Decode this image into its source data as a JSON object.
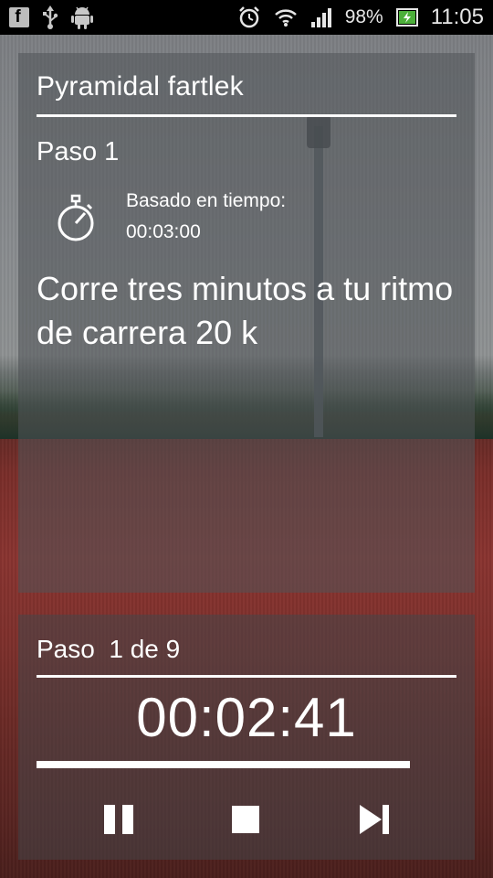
{
  "status_bar": {
    "left_icons": [
      "facebook-icon",
      "usb-icon",
      "android-icon"
    ],
    "right_icons": [
      "alarm-icon",
      "wifi-icon",
      "signal-icon",
      "battery-icon"
    ],
    "battery_percent": "98%",
    "time": "11:05"
  },
  "workout": {
    "title": "Pyramidal fartlek",
    "step_heading": "Paso 1",
    "basis_label": "Basado en tiempo:",
    "basis_value": "00:03:00",
    "instruction": "Corre tres minutos a tu ritmo de carrera 20 k"
  },
  "progress_panel": {
    "step_label": "Paso  1 de 9",
    "timer": "00:02:41",
    "progress_fraction": 0.89
  },
  "controls": {
    "pause_icon": "pause-icon",
    "stop_icon": "stop-icon",
    "next_icon": "skip-next-icon"
  },
  "colors": {
    "accent": "#ffffff",
    "status_bar_bg": "#000000"
  }
}
